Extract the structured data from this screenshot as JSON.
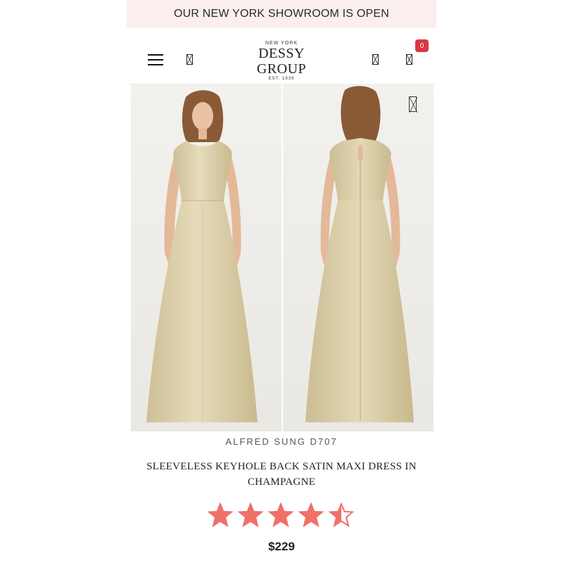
{
  "promo": {
    "text": "OUR NEW YORK SHOWROOM IS OPEN"
  },
  "header": {
    "logo_top": "NEW YORK",
    "logo_main": "DESSY GROUP",
    "logo_bottom": "EST. 1939",
    "cart_count": "0",
    "icons": [
      "menu-icon",
      "search-icon",
      "account-icon",
      "cart-icon"
    ]
  },
  "gallery": {
    "images": [
      "front-view",
      "back-view"
    ],
    "wishlist_icon": "heart-icon"
  },
  "product": {
    "brand": "ALFRED SUNG D707",
    "name": "SLEEVELESS KEYHOLE BACK SATIN MAXI DRESS IN CHAMPAGNE",
    "rating": 4.5,
    "rating_max": 5,
    "price": "$229"
  },
  "colors": {
    "promo_bg": "#fbeeee",
    "badge": "#d9363e",
    "star": "#f0706a",
    "dress": "#dccfa8"
  }
}
